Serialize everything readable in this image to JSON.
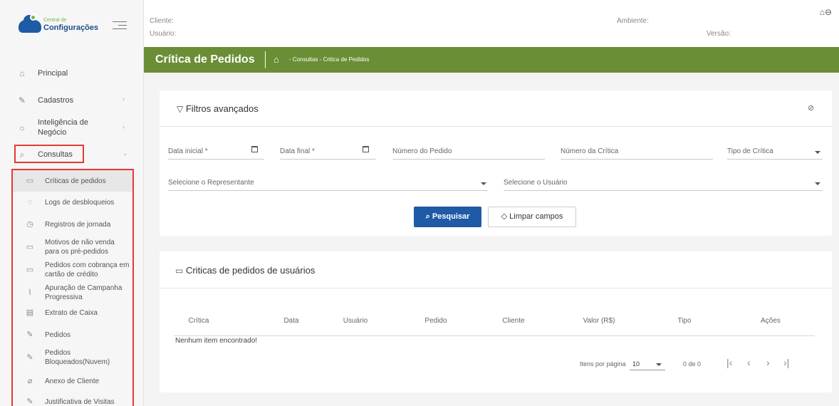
{
  "logo": {
    "small_text": "Central de",
    "big_text": "Configurações"
  },
  "nav": {
    "items": [
      {
        "label": "Principal"
      },
      {
        "label": "Cadastros"
      },
      {
        "label": "Inteligência de Negócio"
      },
      {
        "label": "Consultas"
      }
    ],
    "sub_items": [
      {
        "label": "Críticas de pedidos"
      },
      {
        "label": "Logs de desbloqueios"
      },
      {
        "label": "Registros de jornada"
      },
      {
        "label": "Motivos de não venda para os pré-pedidos"
      },
      {
        "label": "Pedidos com cobrança em cartão de crédito"
      },
      {
        "label": "Apuração de Campanha Progressiva"
      },
      {
        "label": "Extrato de Caixa"
      },
      {
        "label": "Pedidos"
      },
      {
        "label": "Pedidos Bloqueados(Nuvem)"
      },
      {
        "label": "Anexo de Cliente"
      },
      {
        "label": "Justificativa de Visitas"
      }
    ]
  },
  "header": {
    "cliente": "Cliente:",
    "usuario": "Usuário:",
    "ambiente": "Ambiente:",
    "versao": "Versão:"
  },
  "page": {
    "title": "Crítica de Pedidos",
    "breadcrumb": "- Consultas - Critica de Pedidos"
  },
  "filters": {
    "title": "Filtros avançados",
    "data_inicial": "Data inicial *",
    "data_final": "Data final *",
    "numero_pedido": "Número do Pedido",
    "numero_critica": "Número da Crítica",
    "tipo_critica": "Tipo de Crítica",
    "representante": "Selecione o Representante",
    "usuario": "Selecione o Usuário",
    "search_button": "Pesquisar",
    "clear_button": "Limpar campos"
  },
  "table": {
    "title": "Criticas de pedidos de usuários",
    "columns": [
      "Crítica",
      "Data",
      "Usuário",
      "Pedido",
      "Cliente",
      "Valor (R$)",
      "Tipo",
      "Ações"
    ],
    "empty_message": "Nenhum item encontrado!",
    "items_per_page_label": "Itens por página",
    "items_per_page_value": "10",
    "range": "0 de 0"
  }
}
